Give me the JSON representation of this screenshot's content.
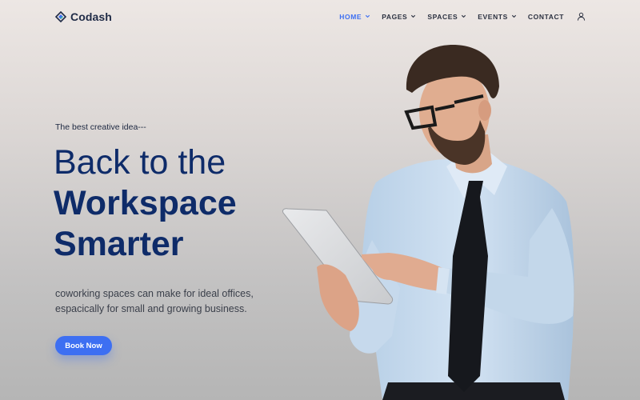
{
  "brand": {
    "name": "Codash",
    "logo_icon": "diamond-logo-icon"
  },
  "nav": {
    "items": [
      {
        "label": "HOME",
        "has_dropdown": true,
        "active": true
      },
      {
        "label": "PAGES",
        "has_dropdown": true,
        "active": false
      },
      {
        "label": "SPACES",
        "has_dropdown": true,
        "active": false
      },
      {
        "label": "EVENTS",
        "has_dropdown": true,
        "active": false
      },
      {
        "label": "CONTACT",
        "has_dropdown": false,
        "active": false
      }
    ],
    "account_icon": "user-icon"
  },
  "hero": {
    "eyebrow": "The best creative idea---",
    "title_line1": "Back to the",
    "title_line2": "Workspace",
    "title_line3": "Smarter",
    "description": "coworking spaces can make for ideal offices, espacically for small and growing business.",
    "cta_label": "Book Now"
  },
  "colors": {
    "accent": "#3d6ff2",
    "heading": "#0e2b69",
    "text": "#3a3f4a",
    "background_top": "#ede7e4",
    "background_bottom": "#b5b5b5"
  }
}
